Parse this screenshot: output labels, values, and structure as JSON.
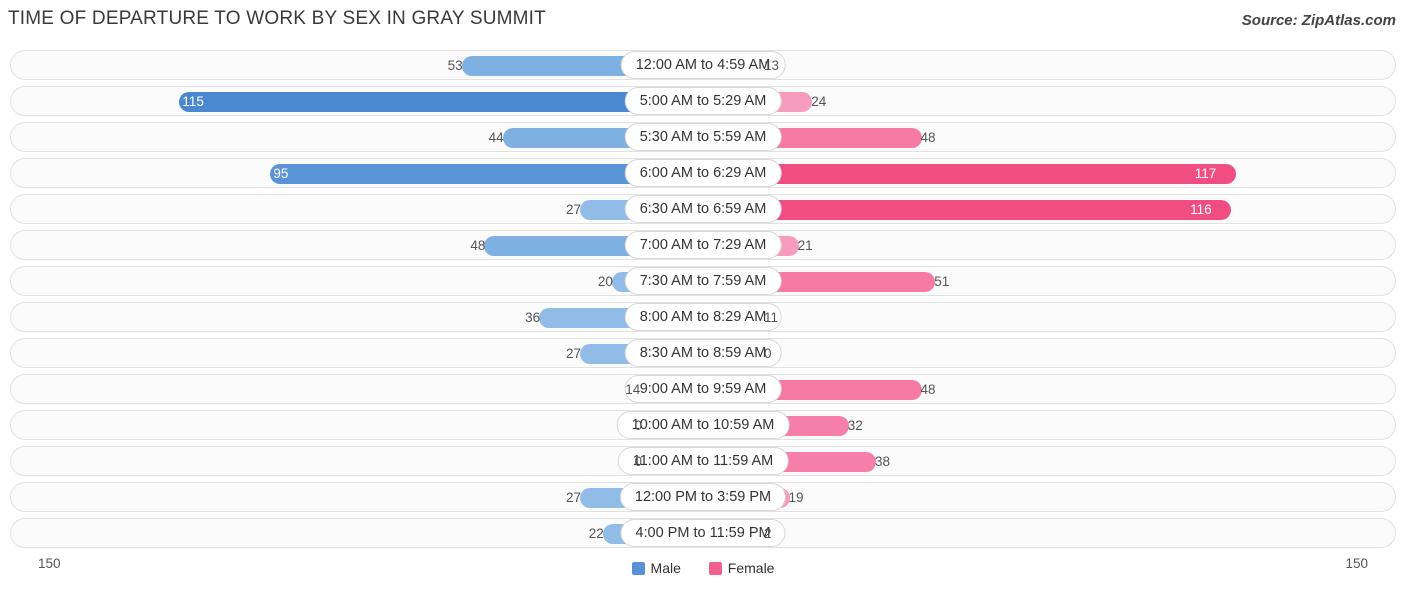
{
  "header": {
    "title": "TIME OF DEPARTURE TO WORK BY SEX IN GRAY SUMMIT",
    "source": "Source: ZipAtlas.com"
  },
  "axis": {
    "left_label": "150",
    "right_label": "150"
  },
  "legend": {
    "male_label": "Male",
    "female_label": "Female",
    "male_color": "#5a91d6",
    "female_color": "#f0608f"
  },
  "chart_data": {
    "type": "bar",
    "orientation": "horizontal-diverging",
    "title": "TIME OF DEPARTURE TO WORK BY SEX IN GRAY SUMMIT",
    "xlabel": "",
    "ylabel": "",
    "xlim": [
      150,
      150
    ],
    "grid": false,
    "legend_position": "bottom-center",
    "categories": [
      "12:00 AM to 4:59 AM",
      "5:00 AM to 5:29 AM",
      "5:30 AM to 5:59 AM",
      "6:00 AM to 6:29 AM",
      "6:30 AM to 6:59 AM",
      "7:00 AM to 7:29 AM",
      "7:30 AM to 7:59 AM",
      "8:00 AM to 8:29 AM",
      "8:30 AM to 8:59 AM",
      "9:00 AM to 9:59 AM",
      "10:00 AM to 10:59 AM",
      "11:00 AM to 11:59 AM",
      "12:00 PM to 3:59 PM",
      "4:00 PM to 11:59 PM"
    ],
    "series": [
      {
        "name": "Male",
        "color": "#5a91d6",
        "values": [
          53,
          115,
          44,
          95,
          27,
          48,
          20,
          36,
          27,
          14,
          0,
          0,
          27,
          22
        ]
      },
      {
        "name": "Female",
        "color": "#f0608f",
        "values": [
          13,
          24,
          48,
          117,
          116,
          21,
          51,
          11,
          0,
          48,
          32,
          38,
          19,
          2
        ]
      }
    ]
  }
}
